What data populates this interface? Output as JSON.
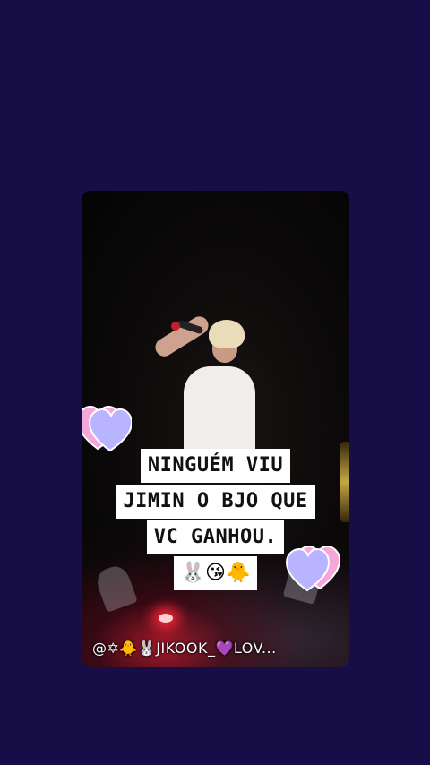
{
  "caption": {
    "line1": "NINGUÉM VIU",
    "line2": "JIMIN O BJO QUE",
    "line3": "VC GANHOU.",
    "emojis": "🐰😘🐥"
  },
  "watermark": {
    "text": "@✡🐥🐰JIKOOK_💜LOV..."
  },
  "colors": {
    "background": "#170e48",
    "caption_bg": "#ffffff",
    "heart_fill": "#b9b4ff",
    "heart_back": "#f4a7d8"
  },
  "icons": {
    "heart_left": "heart-sticker-icon",
    "heart_right": "heart-sticker-icon"
  }
}
